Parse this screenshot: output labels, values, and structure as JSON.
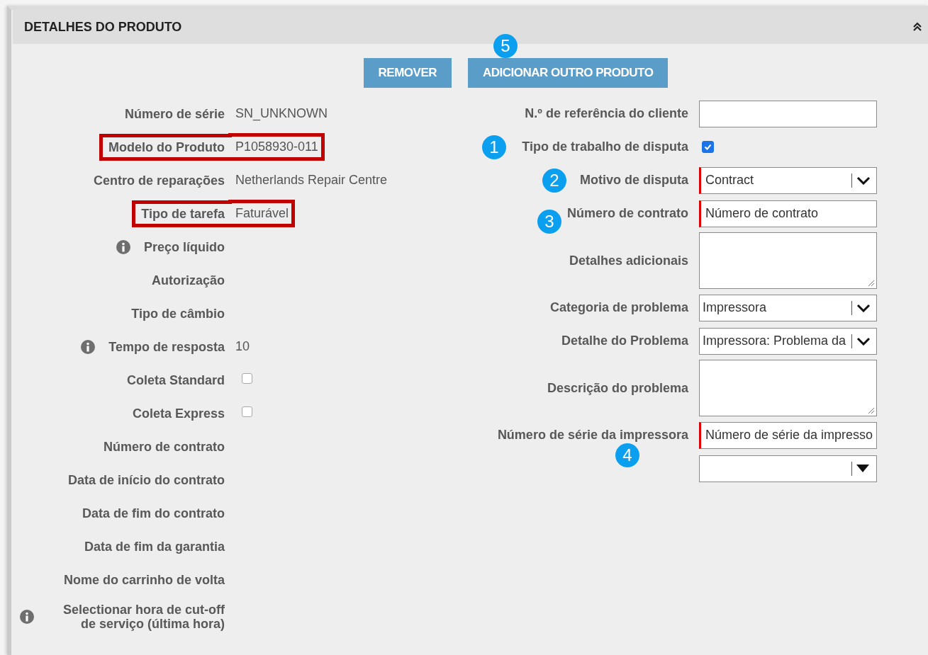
{
  "panel": {
    "title": "DETALHES DO PRODUTO",
    "collapsed": false
  },
  "buttons": [
    {
      "label": "REMOVER"
    },
    {
      "label": "ADICIONAR OUTRO PRODUTO",
      "callout": "5"
    }
  ],
  "left_fields": [
    {
      "kind": "text",
      "label": "Número de série",
      "value": "SN_UNKNOWN",
      "info": false,
      "highlighted": false
    },
    {
      "kind": "text",
      "label": "Modelo do Produto",
      "value": "P1058930-011",
      "info": false,
      "highlighted": true
    },
    {
      "kind": "text",
      "label": "Centro de reparações",
      "value": "Netherlands Repair Centre",
      "info": false,
      "highlighted": false
    },
    {
      "kind": "text",
      "label": "Tipo de tarefa",
      "value": "Faturável",
      "info": false,
      "highlighted": true
    },
    {
      "kind": "text",
      "label": "Preço líquido",
      "info": true,
      "highlighted": false
    },
    {
      "kind": "text",
      "label": "Autorização",
      "info": false,
      "highlighted": false
    },
    {
      "kind": "text",
      "label": "Tipo de câmbio",
      "info": false,
      "highlighted": false
    },
    {
      "kind": "text",
      "label": "Tempo de resposta",
      "value": "10",
      "info": true,
      "highlighted": false
    },
    {
      "kind": "checkbox",
      "label": "Coleta Standard",
      "checked": false,
      "info": false,
      "highlighted": false
    },
    {
      "kind": "checkbox",
      "label": "Coleta Express",
      "checked": false,
      "info": false,
      "highlighted": false
    },
    {
      "kind": "text",
      "label": "Número de contrato",
      "info": false,
      "highlighted": false
    },
    {
      "kind": "text",
      "label": "Data de início do contrato",
      "info": false,
      "highlighted": false
    },
    {
      "kind": "text",
      "label": "Data de fim do contrato",
      "info": false,
      "highlighted": false
    },
    {
      "kind": "text",
      "label": "Data de fim da garantia",
      "info": false,
      "highlighted": false
    },
    {
      "kind": "text",
      "label": "Nome do carrinho de volta",
      "info": false,
      "highlighted": false
    },
    {
      "kind": "text",
      "label": "Selectionar hora de cut-off de serviço (última hora)",
      "info": true,
      "highlighted": false
    }
  ],
  "right_fields": [
    {
      "kind": "input",
      "label": "N.º de referência do cliente",
      "required": false
    },
    {
      "kind": "checkbox",
      "label": "Tipo de trabalho de disputa",
      "checked": true,
      "callout": "1"
    },
    {
      "kind": "select",
      "label": "Motivo de disputa",
      "value": "Contract",
      "required": true,
      "filled_caret": false,
      "callout": "2"
    },
    {
      "kind": "input",
      "label": "Número de contrato",
      "value": "Número de contrato",
      "required": true,
      "callout": "3"
    },
    {
      "kind": "textarea",
      "label": "Detalhes adicionais",
      "required": false
    },
    {
      "kind": "select",
      "label": "Categoria de problema",
      "value": "Impressora",
      "required": false,
      "filled_caret": false
    },
    {
      "kind": "select",
      "label": "Detalhe do Problema",
      "value": "Impressora: Problema da",
      "required": false,
      "filled_caret": false
    },
    {
      "kind": "textarea",
      "label": "Descrição do problema",
      "required": false
    },
    {
      "kind": "input",
      "label": "Número de série da impressora",
      "value": "Número de série da impresso",
      "required": true,
      "callout": "4"
    },
    {
      "kind": "select",
      "required": false,
      "filled_caret": true
    }
  ]
}
